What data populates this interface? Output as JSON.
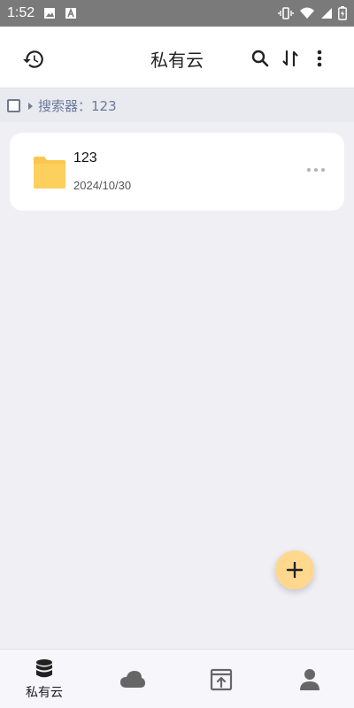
{
  "status_bar": {
    "time": "1:52"
  },
  "app_bar": {
    "title": "私有云"
  },
  "breadcrumb": {
    "text": "搜索器：123"
  },
  "files": [
    {
      "name": "123",
      "date": "2024/10/30",
      "icon": "folder-icon"
    }
  ],
  "bottom_nav": {
    "items": [
      {
        "label": "私有云",
        "icon": "database-icon",
        "active": true
      },
      {
        "label": "",
        "icon": "cloud-icon"
      },
      {
        "label": "",
        "icon": "upload-icon"
      },
      {
        "label": "",
        "icon": "person-icon"
      }
    ]
  },
  "colors": {
    "background": "#efeff4",
    "status_bar": "#7a7a7a",
    "fab": "#ffd88e",
    "folder": "#f9c74f",
    "crumb_text": "#6a7a9a"
  }
}
